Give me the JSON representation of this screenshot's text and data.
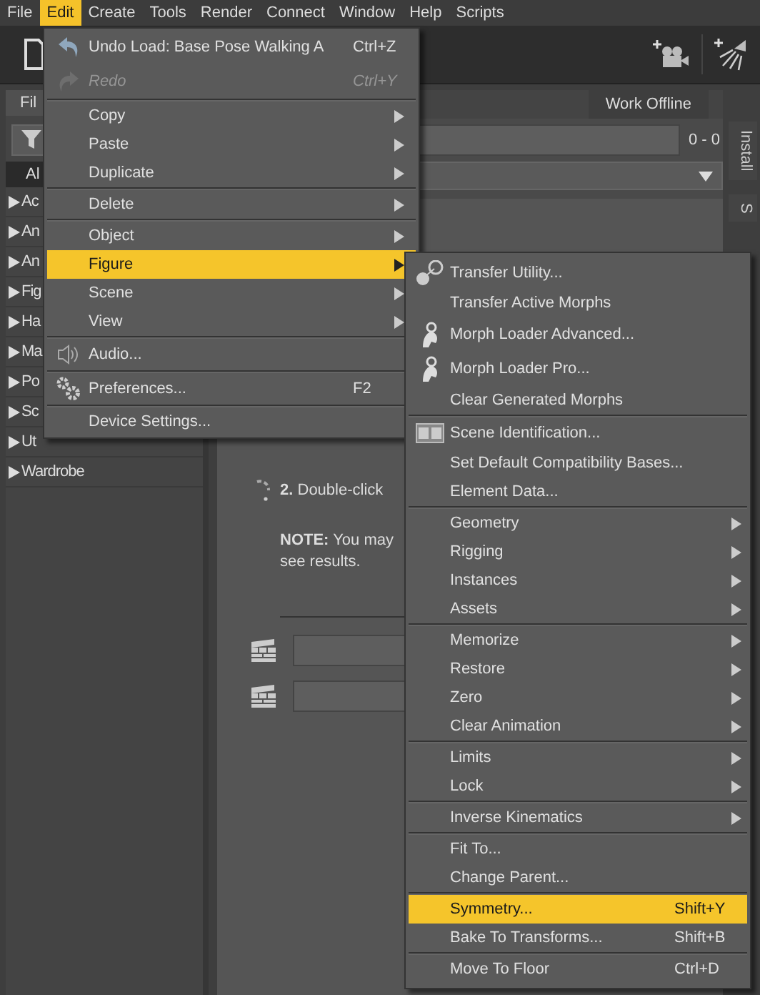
{
  "menubar": [
    {
      "label": "File",
      "selected": false
    },
    {
      "label": "Edit",
      "selected": true
    },
    {
      "label": "Create",
      "selected": false
    },
    {
      "label": "Tools",
      "selected": false
    },
    {
      "label": "Render",
      "selected": false
    },
    {
      "label": "Connect",
      "selected": false
    },
    {
      "label": "Window",
      "selected": false
    },
    {
      "label": "Help",
      "selected": false
    },
    {
      "label": "Scripts",
      "selected": false
    }
  ],
  "left_panel": {
    "tab": "Fil",
    "all_tab": "Al",
    "items": [
      {
        "label": "Ac",
        "expanded": false
      },
      {
        "label": "An",
        "expanded": false
      },
      {
        "label": "An",
        "expanded": false
      },
      {
        "label": "Fig",
        "expanded": false
      },
      {
        "label": "Ha",
        "expanded": false
      },
      {
        "label": "Ma",
        "expanded": false
      },
      {
        "label": "Po",
        "expanded": false
      },
      {
        "label": "Sc",
        "expanded": false
      },
      {
        "label": "Ut",
        "expanded": false
      },
      {
        "label": "Wardrobe",
        "expanded": false
      }
    ]
  },
  "content": {
    "work_offline": "Work Offline",
    "range": "0 - 0",
    "side_tabs": [
      "Install",
      "S"
    ],
    "step": "**2.** Double-click",
    "note_lines": [
      "**NOTE:** You may",
      "see results."
    ]
  },
  "edit_menu": {
    "groups": [
      [
        {
          "label": "Undo Load: Base Pose Walking A",
          "shortcut": "Ctrl+Z",
          "submenu": false,
          "disabled": false,
          "selected": false
        },
        {
          "label": "Redo",
          "shortcut": "Ctrl+Y",
          "submenu": false,
          "disabled": true,
          "selected": false
        }
      ],
      [
        {
          "label": "Copy",
          "submenu": true,
          "disabled": false,
          "selected": false
        },
        {
          "label": "Paste",
          "submenu": true,
          "disabled": false,
          "selected": false
        },
        {
          "label": "Duplicate",
          "submenu": true,
          "disabled": false,
          "selected": false
        }
      ],
      [
        {
          "label": "Delete",
          "submenu": true,
          "disabled": false,
          "selected": false
        }
      ],
      [
        {
          "label": "Object",
          "submenu": true,
          "disabled": false,
          "selected": false
        },
        {
          "label": "Figure",
          "submenu": true,
          "disabled": false,
          "selected": true
        },
        {
          "label": "Scene",
          "submenu": true,
          "disabled": false,
          "selected": false
        },
        {
          "label": "View",
          "submenu": true,
          "disabled": false,
          "selected": false
        }
      ],
      [
        {
          "label": "Audio...",
          "submenu": false,
          "disabled": false,
          "selected": false
        }
      ],
      [
        {
          "label": "Preferences...",
          "shortcut": "F2",
          "submenu": false,
          "disabled": false,
          "selected": false
        }
      ],
      [
        {
          "label": "Device Settings...",
          "submenu": false,
          "disabled": false,
          "selected": false
        }
      ]
    ]
  },
  "figure_menu": {
    "groups": [
      [
        {
          "label": "Transfer Utility...",
          "submenu": false,
          "disabled": false,
          "selected": false
        },
        {
          "label": "Transfer Active Morphs",
          "submenu": false,
          "disabled": false,
          "selected": false
        },
        {
          "label": "Morph Loader Advanced...",
          "submenu": false,
          "disabled": false,
          "selected": false
        },
        {
          "label": "Morph Loader Pro...",
          "submenu": false,
          "disabled": false,
          "selected": false
        },
        {
          "label": "Clear Generated Morphs",
          "submenu": false,
          "disabled": false,
          "selected": false
        }
      ],
      [
        {
          "label": "Scene Identification...",
          "submenu": false,
          "disabled": false,
          "selected": false
        },
        {
          "label": "Set Default Compatibility Bases...",
          "submenu": false,
          "disabled": false,
          "selected": false
        },
        {
          "label": "Element Data...",
          "submenu": false,
          "disabled": false,
          "selected": false
        }
      ],
      [
        {
          "label": "Geometry",
          "submenu": true,
          "disabled": false,
          "selected": false
        },
        {
          "label": "Rigging",
          "submenu": true,
          "disabled": false,
          "selected": false
        },
        {
          "label": "Instances",
          "submenu": true,
          "disabled": false,
          "selected": false
        },
        {
          "label": "Assets",
          "submenu": true,
          "disabled": false,
          "selected": false
        }
      ],
      [
        {
          "label": "Memorize",
          "submenu": true,
          "disabled": false,
          "selected": false
        },
        {
          "label": "Restore",
          "submenu": true,
          "disabled": false,
          "selected": false
        },
        {
          "label": "Zero",
          "submenu": true,
          "disabled": false,
          "selected": false
        },
        {
          "label": "Clear Animation",
          "submenu": true,
          "disabled": false,
          "selected": false
        }
      ],
      [
        {
          "label": "Limits",
          "submenu": true,
          "disabled": false,
          "selected": false
        },
        {
          "label": "Lock",
          "submenu": true,
          "disabled": false,
          "selected": false
        }
      ],
      [
        {
          "label": "Inverse Kinematics",
          "submenu": true,
          "disabled": false,
          "selected": false
        }
      ],
      [
        {
          "label": "Fit To...",
          "submenu": false,
          "disabled": false,
          "selected": false
        },
        {
          "label": "Change Parent...",
          "submenu": false,
          "disabled": false,
          "selected": false
        }
      ],
      [
        {
          "label": "Symmetry...",
          "shortcut": "Shift+Y",
          "submenu": false,
          "disabled": false,
          "selected": true
        },
        {
          "label": "Bake To Transforms...",
          "shortcut": "Shift+B",
          "submenu": false,
          "disabled": false,
          "selected": false
        }
      ],
      [
        {
          "label": "Move To Floor",
          "shortcut": "Ctrl+D",
          "submenu": false,
          "disabled": false,
          "selected": false
        }
      ]
    ]
  }
}
